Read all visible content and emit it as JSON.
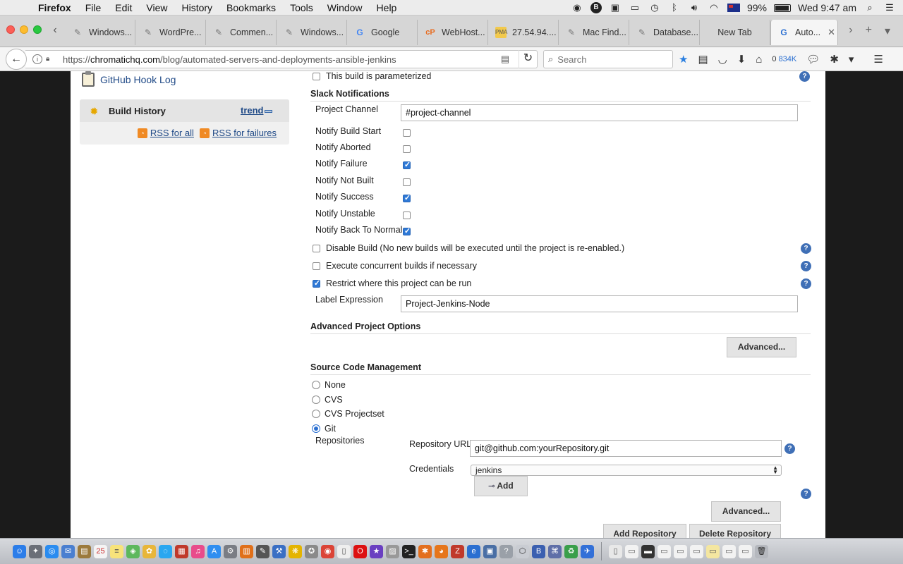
{
  "menubar": {
    "app_name": "Firefox",
    "items": [
      "File",
      "Edit",
      "View",
      "History",
      "Bookmarks",
      "Tools",
      "Window",
      "Help"
    ],
    "battery": "99%",
    "clock": "Wed 9:47 am"
  },
  "tabs": [
    {
      "label": "Windows...",
      "icon": "page-icon"
    },
    {
      "label": "WordPre...",
      "icon": "page-icon"
    },
    {
      "label": "Commen...",
      "icon": "page-icon"
    },
    {
      "label": "Windows...",
      "icon": "page-icon"
    },
    {
      "label": "Google",
      "icon": "google-icon"
    },
    {
      "label": "WebHost...",
      "icon": "cpanel-icon"
    },
    {
      "label": "27.54.94....",
      "icon": "phpmyadmin-icon"
    },
    {
      "label": "Mac Find...",
      "icon": "page-icon"
    },
    {
      "label": "Database...",
      "icon": "page-icon"
    },
    {
      "label": "New Tab",
      "icon": "none"
    },
    {
      "label": "Auto...",
      "icon": "chromatic-icon",
      "active": true
    }
  ],
  "navbar": {
    "url_prefix": "https://",
    "url_host": "chromatichq.com",
    "url_path": "/blog/automated-servers-and-deployments-ansible-jenkins",
    "search_placeholder": "Search",
    "counter_zero": "0",
    "counter_size": "834K"
  },
  "sidebar": {
    "hook_log": "GitHub Hook Log",
    "build_history_title": "Build History",
    "trend_link": "trend",
    "rss_all": "RSS for all",
    "rss_failures": "RSS for failures"
  },
  "config": {
    "parameterized_label": "This build is parameterized",
    "slack_section": "Slack Notifications",
    "project_channel_label": "Project Channel",
    "project_channel_value": "#project-channel",
    "notify_options": [
      {
        "label": "Notify Build Start",
        "checked": false
      },
      {
        "label": "Notify Aborted",
        "checked": false
      },
      {
        "label": "Notify Failure",
        "checked": true
      },
      {
        "label": "Notify Not Built",
        "checked": false
      },
      {
        "label": "Notify Success",
        "checked": true
      },
      {
        "label": "Notify Unstable",
        "checked": false
      },
      {
        "label": "Notify Back To Normal",
        "checked": true
      }
    ],
    "disable_build_label": "Disable Build (No new builds will be executed until the project is re-enabled.)",
    "concurrent_label": "Execute concurrent builds if necessary",
    "restrict_label": "Restrict where this project can be run",
    "label_expression_label": "Label Expression",
    "label_expression_value": "Project-Jenkins-Node",
    "advanced_options_section": "Advanced Project Options",
    "advanced_button": "Advanced...",
    "scm_section": "Source Code Management",
    "scm_options": [
      {
        "label": "None",
        "selected": false
      },
      {
        "label": "CVS",
        "selected": false
      },
      {
        "label": "CVS Projectset",
        "selected": false
      },
      {
        "label": "Git",
        "selected": true
      }
    ],
    "repositories_label": "Repositories",
    "repo_url_label": "Repository URL",
    "repo_url_value": "git@github.com:yourRepository.git",
    "credentials_label": "Credentials",
    "credentials_value": "jenkins",
    "add_button": "Add",
    "repo_advanced_button": "Advanced...",
    "add_repository_button": "Add Repository",
    "delete_repository_button": "Delete Repository"
  }
}
